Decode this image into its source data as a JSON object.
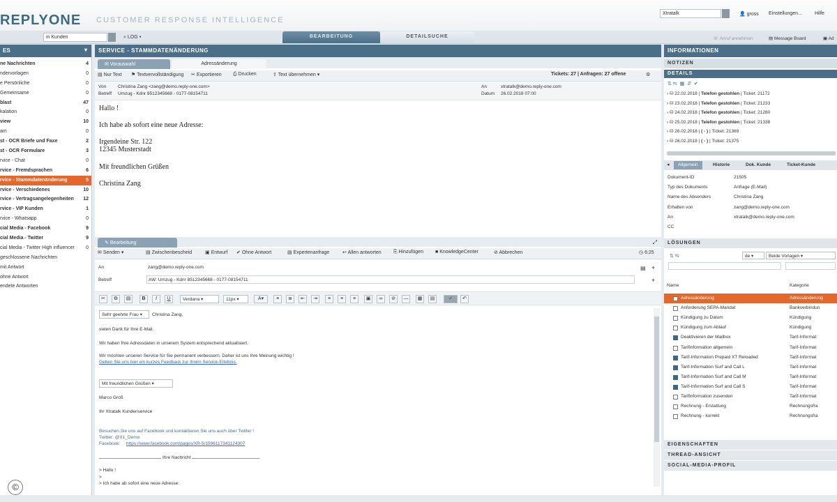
{
  "header": {
    "logo": "REPLYONE",
    "tagline": "CUSTOMER RESPONSE INTELLIGENCE",
    "search_value": "Xtratalk",
    "user": "gross",
    "settings": "Einstellungen...",
    "help": "Hilfe"
  },
  "subbar": {
    "search_value": "in Kunden",
    "log_label": "LOG",
    "tab_bearbeitung": "BEARBEITUNG",
    "tab_detailsuche": "DETAILSUCHE",
    "anruf": "Anruf annehmen",
    "message_board": "Message Board",
    "adm": "Ad"
  },
  "sidebar": {
    "title": "ES",
    "items": [
      {
        "label": "ne Nachrichten",
        "count": "4",
        "bold": true
      },
      {
        "label": "ndervorlagen",
        "count": "0",
        "bold": false
      },
      {
        "label": "e Persönliche",
        "count": "0",
        "bold": false
      },
      {
        "label": "Gemeinsame",
        "count": "0",
        "bold": false
      },
      {
        "label": "blast",
        "count": "47",
        "bold": true
      },
      {
        "label": "kalation",
        "count": "0",
        "bold": false
      },
      {
        "label": "view",
        "count": "10",
        "bold": true
      },
      {
        "label": "am",
        "count": "0",
        "bold": false
      },
      {
        "label": "st - OCR Briefe und Faxe",
        "count": "2",
        "bold": true
      },
      {
        "label": "st - OCR Formulare",
        "count": "3",
        "bold": true
      },
      {
        "label": "rvice - Chat",
        "count": "0",
        "bold": false
      },
      {
        "label": "rvice - Fremdsprachen",
        "count": "6",
        "bold": true
      },
      {
        "label": "rvice - Stammdatenänderung",
        "count": "5",
        "bold": true,
        "selected": true
      },
      {
        "label": "rvice - Verschiedenes",
        "count": "10",
        "bold": true
      },
      {
        "label": "rvice - Vertragsangelegenheiten",
        "count": "12",
        "bold": true
      },
      {
        "label": "rvice - VIP Kunden",
        "count": "1",
        "bold": true
      },
      {
        "label": "rvice - Whatsapp",
        "count": "0",
        "bold": false
      },
      {
        "label": "cial Media - Facebook",
        "count": "9",
        "bold": true
      },
      {
        "label": "cial Media - Twitter",
        "count": "9",
        "bold": true
      },
      {
        "label": "cial Media - Twitter High influencer",
        "count": "0",
        "bold": false
      },
      {
        "label": "geschlossene Nachrichten",
        "count": "",
        "bold": false
      },
      {
        "label": "mit Antwort",
        "count": "",
        "bold": false
      },
      {
        "label": "ohne Antwort",
        "count": "",
        "bold": false
      },
      {
        "label": "endete Antworten",
        "count": "",
        "bold": false
      }
    ]
  },
  "center": {
    "title": "SERVICE - STAMMDATENÄNDERUNG",
    "tab_vorauswahl": "Vorauswahl",
    "tab_adressaenderung": "Adressänderung",
    "tools": [
      "Nur Text",
      "Textvervollständigung",
      "Exportieren",
      "Drucken",
      "Text übernehmen"
    ],
    "tickets": "Tickets: 27 | Anfragen: 27 offene",
    "von_label": "Von",
    "von": "Christina Zang <zang@demo.reply-one.com>",
    "betreff_label": "Betreff",
    "betreff": "Umzug - Kdnr 8512345668 - 0177-08154711",
    "an_label": "An",
    "an": "xtratalk@demo.reply-one.com",
    "datum_label": "Datum",
    "datum": "26.02.2018 07:00",
    "message": [
      "Hallo !",
      "Ich habe ab sofort eine neue Adresse:",
      "Irgendeine Str. 122",
      "12345 Musterstadt",
      "Mit freundlichen Grüßen",
      "Christina Zang"
    ],
    "bearbeitung_tab": "Bearbeitung",
    "reply_tools": [
      "Senden",
      "Zwischenbescheid",
      "Entwurf",
      "Ohne Antwort",
      "Expertenanfrage",
      "Allen antworten",
      "Hinzufügen",
      "KnowledgeCenter",
      "Abbrechen"
    ],
    "timer": "6:25",
    "reply_an_label": "An",
    "reply_an": "zang@demo.reply-one.com",
    "reply_betreff_label": "Betreff",
    "reply_betreff": "AW: Umzug - Kdnr 8512345668 - 0177-08154711",
    "font": "Verdana",
    "size": "11px",
    "reply": {
      "salutation": "Sehr geehrte Frau",
      "name": "Christina Zang,",
      "l1": "vielen Dank für Ihre E-Mail.",
      "l2": "Wir haben Ihre Adressdaten in unserem System entsprechend aktualisiert.",
      "l3": "Wir möchten unseren Service für Sie permanent verbessern. Daher ist uns Ihre Meinung wichtig !",
      "l4": "Geben Sie uns hier ein kurzes Feedback zur Ihrem Service-Erlebnis.",
      "closing": "Mit freundlichen Grüßen",
      "agent": "Marco Groß",
      "team": "Ihr Xtratalk Kundenservice",
      "fb1": "Besuchen Sie uns auf Facebook und kontaktieren Sie uns auch über Twitter !",
      "fb2": "Twitter: @X1_Demo",
      "fb3_label": "Facebook:",
      "fb3": "https://www.facebook.com/pages/XR-5/1596117341124307",
      "ihre": "Ihre Nachricht",
      "q1": "> Hallo !",
      "q2": ">",
      "q3": "> Ich habe ab sofort eine neue Adresse:"
    }
  },
  "right": {
    "title": "INFORMATIONEN",
    "notizen": "NOTIZEN",
    "details": "DETAILS",
    "tickets": [
      {
        "date": "22.02.2018",
        "type": "Telefon gestohlen",
        "ticket": "Ticket: 21172"
      },
      {
        "date": "23.02.2018",
        "type": "Telefon gestohlen",
        "ticket": "Ticket: 21233"
      },
      {
        "date": "24.02.2018",
        "type": "Telefon gestohlen",
        "ticket": "Ticket: 21280"
      },
      {
        "date": "25.02.2018",
        "type": "Telefon gestohlen",
        "ticket": "Ticket: 21338"
      },
      {
        "date": "26.02.2018",
        "type": "( - )",
        "ticket": "Ticket: 21369"
      },
      {
        "date": "26.02.2018",
        "type": "( - )",
        "ticket": "Ticket: 21375"
      }
    ],
    "tabs": [
      "Allgemein",
      "Historie",
      "Dok. Kunde",
      "Ticket-Kunde"
    ],
    "kv": [
      {
        "k": "Dokument-ID",
        "v": "21505"
      },
      {
        "k": "Typ des Dokuments",
        "v": "Anfrage (E-Mail)"
      },
      {
        "k": "Name des Absenders",
        "v": "Christina Zang"
      },
      {
        "k": "Erhalten von",
        "v": "zang@demo.reply-one.com"
      },
      {
        "k": "An",
        "v": "xtratalk@demo.reply-one.com"
      },
      {
        "k": "CC",
        "v": ""
      }
    ],
    "loesungen": "LÖSUNGEN",
    "lang": "de",
    "vorlagen": "Beide Vorlagen",
    "col_name": "Name",
    "col_kat": "Kategorie",
    "solutions": [
      {
        "name": "Adressänderung",
        "kat": "Adressänderung",
        "filled": false,
        "sel": true
      },
      {
        "name": "Anforderung SEPA-Mandat",
        "kat": "Bankverbindun",
        "filled": false
      },
      {
        "name": "Kündigung zu Datum",
        "kat": "Kündigung",
        "filled": false
      },
      {
        "name": "Kündigung zum Ablauf",
        "kat": "Kündigung",
        "filled": false
      },
      {
        "name": "Deaktivieren der Mailbox",
        "kat": "Tarif-Informat",
        "filled": true
      },
      {
        "name": "Tarifinformation allgemein",
        "kat": "Tarif-Informat",
        "filled": false
      },
      {
        "name": "Tarif-Information Prepaid XT Reloaded",
        "kat": "Tarif-Informat",
        "filled": true
      },
      {
        "name": "Tarif-Information Surf and Call L",
        "kat": "Tarif-Informat",
        "filled": true
      },
      {
        "name": "Tarif-Information Surf and Call M",
        "kat": "Tarif-Informat",
        "filled": true
      },
      {
        "name": "Tarif-Information Surf and Call S",
        "kat": "Tarif-Informat",
        "filled": true
      },
      {
        "name": "Tarifinformation zusenden",
        "kat": "Tarif-Informat",
        "filled": false
      },
      {
        "name": "Rechnung - Erstattung",
        "kat": "Rechnungsfra",
        "filled": false
      },
      {
        "name": "Rechnung - korrekt",
        "kat": "Rechnungsfra",
        "filled": false
      }
    ],
    "eigenschaften": "EIGENSCHAFTEN",
    "thread": "THREAD-ANSICHT",
    "social": "SOCIAL-MEDIA-PROFIL"
  },
  "footer": {
    "copyright": "©"
  }
}
